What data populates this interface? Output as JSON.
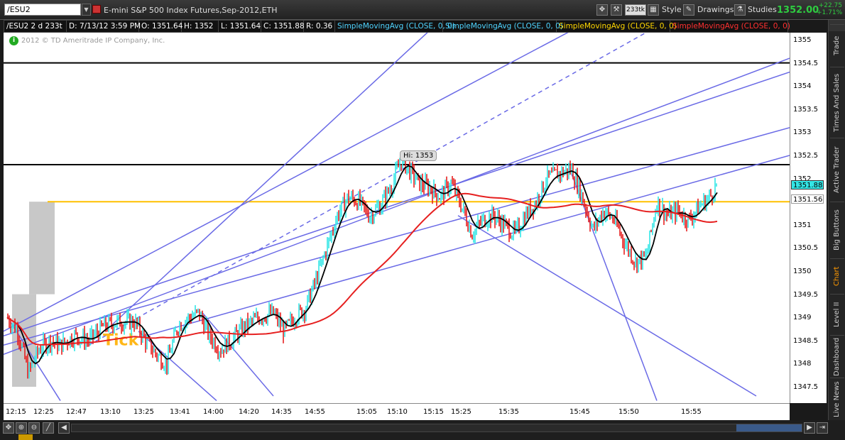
{
  "header": {
    "symbol": "/ESU2",
    "description": "E-mini S&P 500 Index Futures,Sep-2012,ETH",
    "aggregation": "233tk",
    "style_label": "Style",
    "drawings_label": "Drawings",
    "studies_label": "Studies",
    "last_price": "1352.00",
    "net_change": "+22.75",
    "percent_change": "+1.71%"
  },
  "infobar": {
    "title": "/ESU2 2 d 233t",
    "date": "D: 7/13/12 3:59 PM",
    "open": "O: 1351.64",
    "high": "H: 1352",
    "low": "L: 1351.64",
    "close": "C: 1351.88",
    "range": "R: 0.36",
    "sma1": "SimpleMovingAvg (CLOSE, 0, 0)",
    "sma2": "SimpleMovingAvg (CLOSE, 0, 0)",
    "sma3": "SimpleMovingAvg (CLOSE, 0, 0)",
    "sma4": "SimpleMovingAvg (CLOSE, 0, 0)"
  },
  "chart": {
    "copyright": "2012 © TD Ameritrade IP Company, Inc.",
    "hi_label": "Hi: 1353",
    "watermark": "Tick",
    "last_tag": "1351.88",
    "sma_tag": "1351.56",
    "colors": {
      "up": "#33e6e6",
      "down": "#e62020",
      "sma_black": "#000000",
      "sma_red": "#e62020",
      "trend": "#6a6ae6",
      "yellow": "#ffc000"
    }
  },
  "yaxis": {
    "ticks": [
      "1355",
      "1354.5",
      "1354",
      "1353.5",
      "1353",
      "1352.5",
      "1352",
      "1351.5",
      "1351",
      "1350.5",
      "1350",
      "1349.5",
      "1349",
      "1348.5",
      "1348",
      "1347.5"
    ]
  },
  "xaxis": {
    "ticks": [
      "12:15",
      "12:25",
      "12:47",
      "13:10",
      "13:25",
      "13:41",
      "14:00",
      "14:20",
      "14:35",
      "14:55",
      "15:05",
      "15:10",
      "15:15",
      "15:25",
      "15:35",
      "15:45",
      "15:50",
      "15:55"
    ]
  },
  "sidebar": {
    "tabs": [
      "Trade",
      "Times And Sales",
      "Active Trader",
      "Big Buttons",
      "Chart",
      "Level II",
      "Dashboard",
      "Live News"
    ]
  }
}
